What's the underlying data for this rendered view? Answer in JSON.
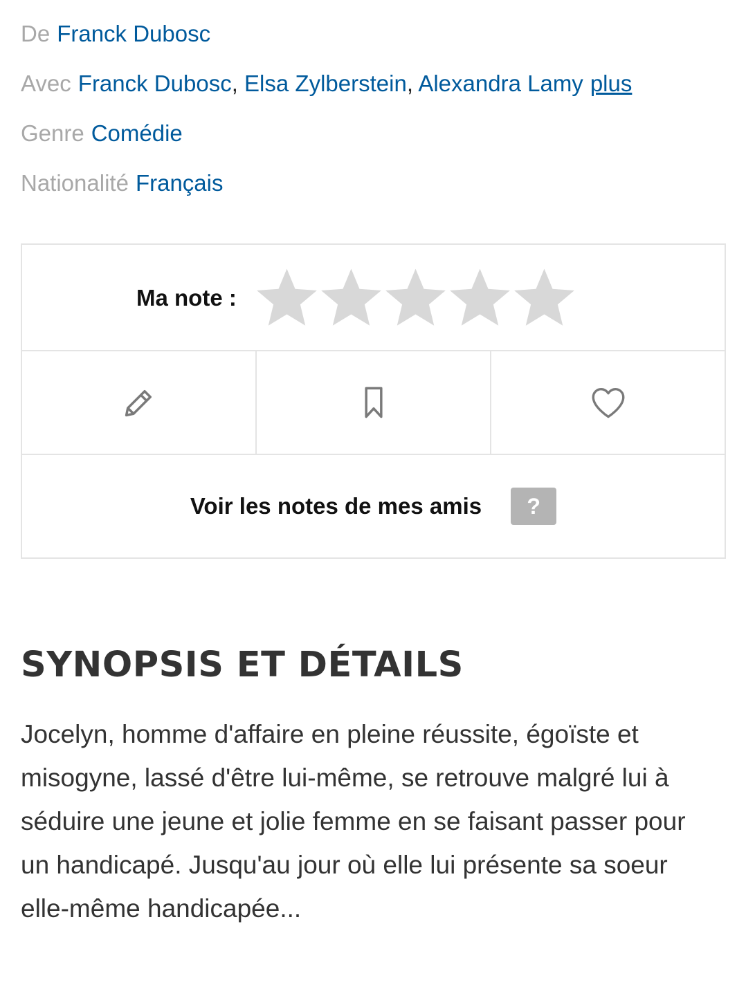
{
  "credits": {
    "director_label": "De",
    "director": "Franck Dubosc",
    "cast_label": "Avec",
    "cast": [
      "Franck Dubosc",
      "Elsa Zylberstein",
      "Alexandra Lamy"
    ],
    "separator": ",",
    "more_label": "plus",
    "genre_label": "Genre",
    "genre": "Comédie",
    "nationality_label": "Nationalité",
    "nationality": "Français"
  },
  "rating": {
    "label": "Ma note :",
    "value": 0,
    "max": 5,
    "star_color": "#d8d8d8"
  },
  "actions": {
    "items": [
      {
        "icon": "pencil-icon",
        "action": "write-review"
      },
      {
        "icon": "bookmark-icon",
        "action": "watchlist"
      },
      {
        "icon": "heart-icon",
        "action": "favorite"
      }
    ],
    "icon_color": "#7a7a7a"
  },
  "friends": {
    "label": "Voir les notes de mes amis",
    "help": "?"
  },
  "synopsis": {
    "title": "SYNOPSIS ET DÉTAILS",
    "text": "Jocelyn, homme d'affaire en pleine réussite, égoïste et misogyne, lassé d'être lui-même, se retrouve malgré lui à séduire une jeune et jolie femme en se faisant passer pour un handicapé. Jusqu'au jour où elle lui présente sa soeur elle-même handicapée..."
  },
  "colors": {
    "link": "#005a9c",
    "label": "#a8a8a8",
    "text": "#333333",
    "border": "#e4e4e4"
  }
}
